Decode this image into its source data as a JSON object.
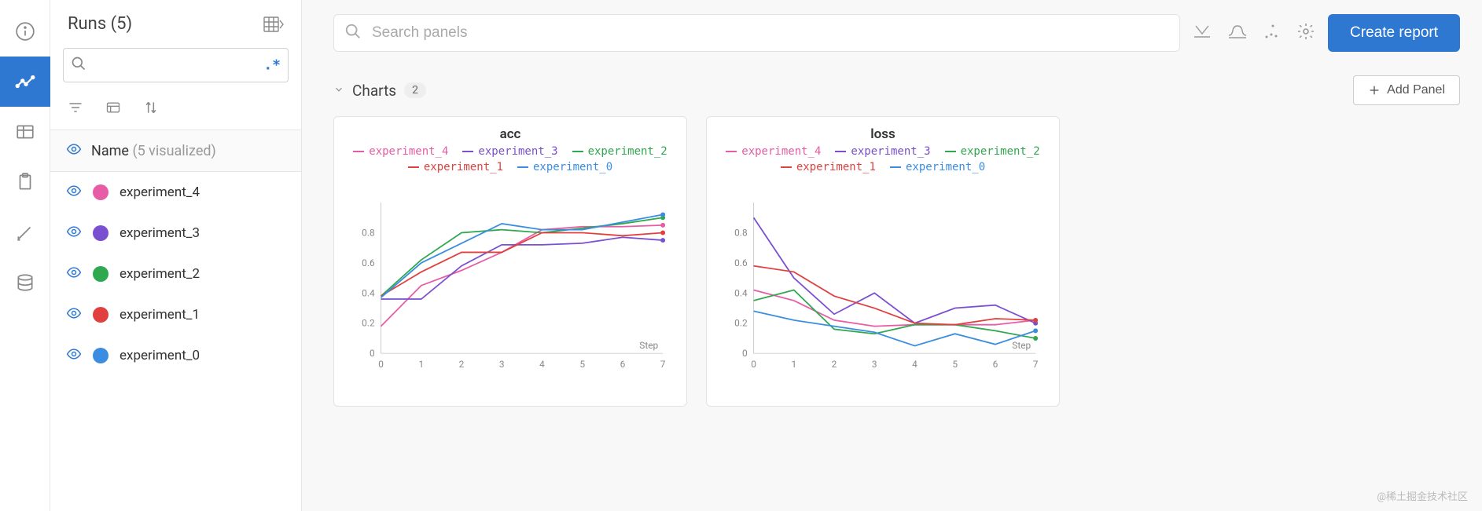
{
  "sidebar": {
    "title": "Runs (5)",
    "search_placeholder": "",
    "regex_indicator": ".*",
    "name_header": "Name",
    "name_sub": "(5 visualized)",
    "runs": [
      {
        "name": "experiment_4",
        "color": "#e85ca5"
      },
      {
        "name": "experiment_3",
        "color": "#7a4fd1"
      },
      {
        "name": "experiment_2",
        "color": "#2fa84f"
      },
      {
        "name": "experiment_1",
        "color": "#e0413f"
      },
      {
        "name": "experiment_0",
        "color": "#3a8de0"
      }
    ]
  },
  "topbar": {
    "search_placeholder": "Search panels",
    "create_label": "Create report"
  },
  "section": {
    "title": "Charts",
    "count": "2",
    "add_panel_label": "Add Panel"
  },
  "watermark": "@稀土掘金技术社区",
  "chart_data": [
    {
      "type": "line",
      "title": "acc",
      "xlabel": "Step",
      "ylabel": "",
      "xlim": [
        0,
        7
      ],
      "ylim": [
        0,
        1
      ],
      "yticks": [
        0,
        0.2,
        0.4,
        0.6,
        0.8
      ],
      "xticks": [
        0,
        1,
        2,
        3,
        4,
        5,
        6,
        7
      ],
      "x": [
        0,
        1,
        2,
        3,
        4,
        5,
        6,
        7
      ],
      "series": [
        {
          "name": "experiment_4",
          "color": "#e85ca5",
          "values": [
            0.18,
            0.45,
            0.55,
            0.67,
            0.82,
            0.84,
            0.84,
            0.85
          ]
        },
        {
          "name": "experiment_3",
          "color": "#7a4fd1",
          "values": [
            0.36,
            0.36,
            0.58,
            0.72,
            0.72,
            0.73,
            0.77,
            0.75
          ]
        },
        {
          "name": "experiment_2",
          "color": "#2fa84f",
          "values": [
            0.38,
            0.62,
            0.8,
            0.82,
            0.8,
            0.83,
            0.86,
            0.9
          ]
        },
        {
          "name": "experiment_1",
          "color": "#e0413f",
          "values": [
            0.38,
            0.54,
            0.67,
            0.67,
            0.8,
            0.8,
            0.78,
            0.8
          ]
        },
        {
          "name": "experiment_0",
          "color": "#3a8de0",
          "values": [
            0.37,
            0.6,
            0.73,
            0.86,
            0.82,
            0.82,
            0.87,
            0.92
          ]
        }
      ]
    },
    {
      "type": "line",
      "title": "loss",
      "xlabel": "Step",
      "ylabel": "",
      "xlim": [
        0,
        7
      ],
      "ylim": [
        0,
        1
      ],
      "yticks": [
        0,
        0.2,
        0.4,
        0.6,
        0.8
      ],
      "xticks": [
        0,
        1,
        2,
        3,
        4,
        5,
        6,
        7
      ],
      "x": [
        0,
        1,
        2,
        3,
        4,
        5,
        6,
        7
      ],
      "series": [
        {
          "name": "experiment_4",
          "color": "#e85ca5",
          "values": [
            0.42,
            0.35,
            0.22,
            0.18,
            0.19,
            0.19,
            0.19,
            0.22
          ]
        },
        {
          "name": "experiment_3",
          "color": "#7a4fd1",
          "values": [
            0.9,
            0.5,
            0.26,
            0.4,
            0.2,
            0.3,
            0.32,
            0.2
          ]
        },
        {
          "name": "experiment_2",
          "color": "#2fa84f",
          "values": [
            0.35,
            0.42,
            0.16,
            0.13,
            0.19,
            0.19,
            0.15,
            0.1
          ]
        },
        {
          "name": "experiment_1",
          "color": "#e0413f",
          "values": [
            0.58,
            0.54,
            0.38,
            0.3,
            0.2,
            0.19,
            0.23,
            0.22
          ]
        },
        {
          "name": "experiment_0",
          "color": "#3a8de0",
          "values": [
            0.28,
            0.22,
            0.18,
            0.14,
            0.05,
            0.13,
            0.06,
            0.15
          ]
        }
      ]
    }
  ]
}
